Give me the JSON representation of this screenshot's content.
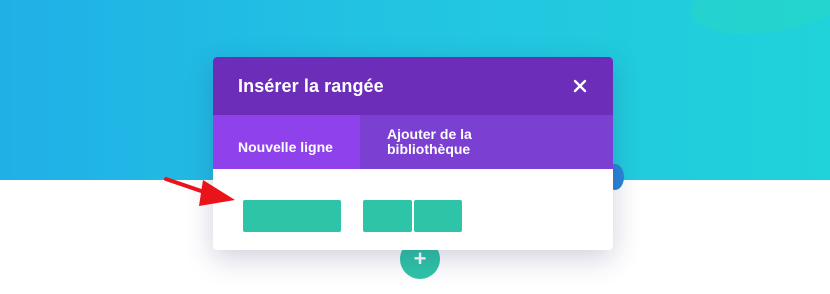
{
  "modal": {
    "title": "Insérer la rangée",
    "tabs": [
      {
        "label": "Nouvelle ligne",
        "active": true
      },
      {
        "label": "Ajouter de la",
        "label_line2": "bibliothèque",
        "active": false
      }
    ],
    "layouts": [
      {
        "name": "one-column",
        "columns": 1
      },
      {
        "name": "two-columns",
        "columns": 2
      }
    ]
  },
  "colors": {
    "hero_gradient_start": "#20b0e6",
    "hero_gradient_end": "#20d2da",
    "header_purple": "#6c2eb9",
    "tab_bar_purple": "#7b40d2",
    "active_tab_purple": "#8f42ec",
    "layout_teal": "#2ec4a8",
    "arrow_red": "#e8141a"
  },
  "icons": {
    "close": "close-icon",
    "add": "plus-icon",
    "annotation": "red-arrow-icon"
  }
}
